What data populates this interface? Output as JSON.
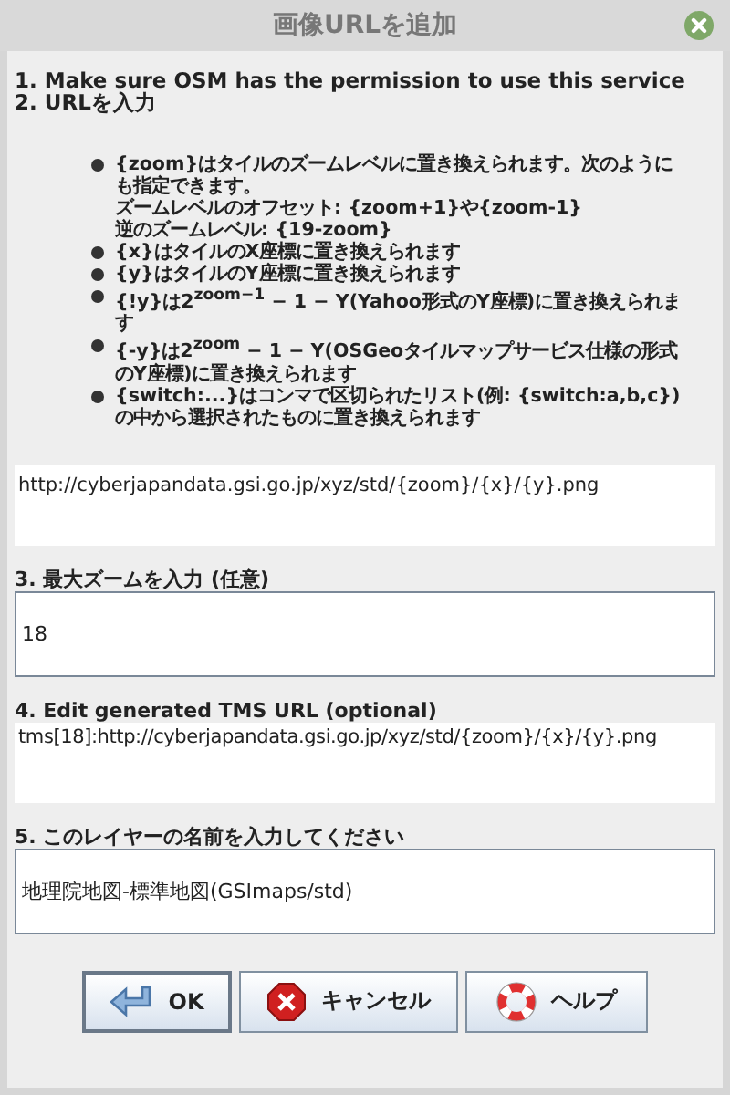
{
  "window": {
    "title": "画像URLを追加"
  },
  "steps": [
    "1. Make sure OSM has the permission to use this service",
    "2. URLを入力"
  ],
  "bullets": [
    {
      "lines": [
        "{zoom}はタイルのズームレベルに置き換えられます。次のようにも指定できます。",
        "ズームレベルのオフセット: {zoom+1}や{zoom-1}",
        "逆のズームレベル: {19-zoom}"
      ]
    },
    {
      "lines": [
        "{x}はタイルのX座標に置き換えられます"
      ]
    },
    {
      "lines": [
        "{y}はタイルのY座標に置き換えられます"
      ]
    },
    {
      "lines": [
        "{!y}は2$^{zoom−1}$ − 1 − Y(Yahoo形式のY座標)に置き換えられます"
      ]
    },
    {
      "lines": [
        "{-y}は2$^{zoom}$ − 1 − Y(OSGeoタイルマップサービス仕様の形式のY座標)に置き換えられます"
      ]
    },
    {
      "lines": [
        "{switch:...}はコンマで区切られたリスト(例: {switch:a,b,c})の中から選択されたものに置き換えられます"
      ]
    }
  ],
  "url_value": "http://cyberjapandata.gsi.go.jp/xyz/std/{zoom}/{x}/{y}.png",
  "max_zoom": {
    "label": "3. 最大ズームを入力 (任意)",
    "value": "18"
  },
  "tms": {
    "label": "4. Edit generated TMS URL (optional)",
    "value": "tms[18]:http://cyberjapandata.gsi.go.jp/xyz/std/{zoom}/{x}/{y}.png"
  },
  "name": {
    "label": "5. このレイヤーの名前を入力してください",
    "value": "地理院地図-標準地図(GSImaps/std)"
  },
  "buttons": [
    {
      "kind": "ok",
      "label": "OK",
      "selected": true
    },
    {
      "kind": "cancel",
      "label": "キャンセル",
      "selected": false
    },
    {
      "kind": "help",
      "label": "ヘルプ",
      "selected": false
    }
  ]
}
